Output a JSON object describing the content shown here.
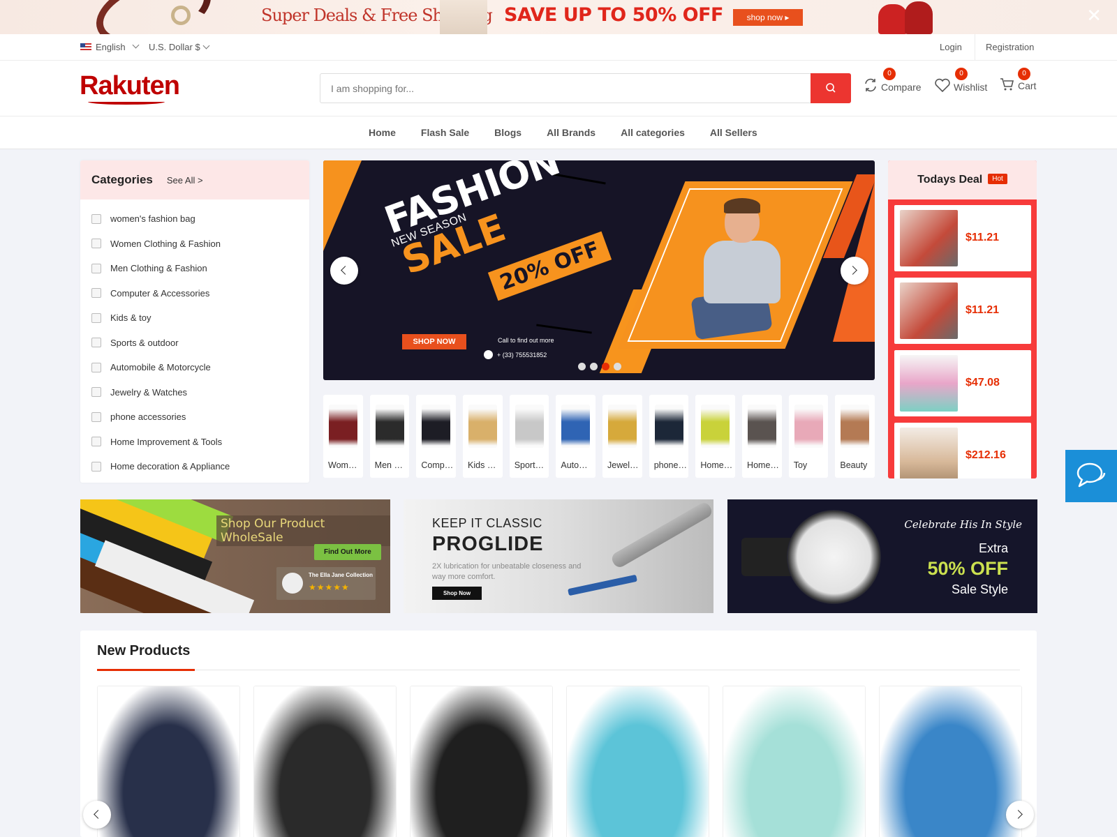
{
  "promo_banner": {
    "headline": "Super Deals & Free Shipping",
    "offer": "SAVE UP TO 50% OFF",
    "cta": "shop now ▸",
    "close_icon": "close-icon"
  },
  "utility_bar": {
    "language": "English",
    "currency": "U.S. Dollar $",
    "login": "Login",
    "registration": "Registration"
  },
  "header": {
    "logo": "Rakuten",
    "search_placeholder": "I am shopping for...",
    "compare": {
      "label": "Compare",
      "count": "0"
    },
    "wishlist": {
      "label": "Wishlist",
      "count": "0"
    },
    "cart": {
      "label": "Cart",
      "count": "0"
    }
  },
  "nav": {
    "items": [
      "Home",
      "Flash Sale",
      "Blogs",
      "All Brands",
      "All categories",
      "All Sellers"
    ]
  },
  "categories": {
    "title": "Categories",
    "see_all": "See All >",
    "items": [
      "women's fashion bag",
      "Women Clothing & Fashion",
      "Men Clothing & Fashion",
      "Computer & Accessories",
      "Kids & toy",
      "Sports & outdoor",
      "Automobile & Motorcycle",
      "Jewelry & Watches",
      "phone accessories",
      "Home Improvement & Tools",
      "Home decoration & Appliance"
    ]
  },
  "hero_slider": {
    "tagline": "NEW SEASON",
    "title": "FASHION",
    "subtitle": "SALE",
    "discount": "20% OFF",
    "cta": "SHOP NOW",
    "call_text": "Call to find out more",
    "phone": "+ (33) 755531852",
    "active_slide": 3,
    "slide_count": 4
  },
  "category_tiles": [
    {
      "label": "Women Clothing & Fashion",
      "color": "#7a1f22"
    },
    {
      "label": "Men Clothing & Fashion",
      "color": "#2b2b2b"
    },
    {
      "label": "Computer & Accessories",
      "color": "#1d1d25"
    },
    {
      "label": "Kids & toy",
      "color": "#d9b06a"
    },
    {
      "label": "Sports & outdoor",
      "color": "#c8c8c8"
    },
    {
      "label": "Automobile & Motorcycle",
      "color": "#2f64b4"
    },
    {
      "label": "Jewelry & Watches",
      "color": "#d6a93b"
    },
    {
      "label": "phone accessories",
      "color": "#1c2738"
    },
    {
      "label": "Home Improvement & Tools",
      "color": "#c9d23a"
    },
    {
      "label": "Home decoration & Appliance",
      "color": "#5a5350"
    },
    {
      "label": "Toy",
      "color": "#e8a9b8"
    },
    {
      "label": "Beauty",
      "color": "#b47a54"
    }
  ],
  "todays_deal": {
    "title": "Todays Deal",
    "badge": "Hot",
    "items": [
      {
        "price": "$11.21",
        "color": "#c44a3a"
      },
      {
        "price": "$11.21",
        "color": "#c44a3a"
      },
      {
        "price": "$47.08",
        "color": "#e9a6c9"
      },
      {
        "price": "$212.16",
        "color": "#d8b99a"
      }
    ]
  },
  "promo_tiles": {
    "wholesale": {
      "title": "Shop Our Product WholeSale",
      "cta": "Find Out More",
      "brand": "The Ella Jane Collection",
      "rating": "★★★★★"
    },
    "proglide": {
      "kicker": "KEEP IT CLASSIC",
      "title": "PROGLIDE",
      "desc": "2X lubrication for unbeatable closeness and way more comfort.",
      "cta": "Shop Now"
    },
    "watch": {
      "kicker": "Celebrate His In Style",
      "line1": "Extra",
      "line2": "50% OFF",
      "line3": "Sale Style"
    }
  },
  "new_products": {
    "title": "New Products",
    "items": [
      {
        "color": "#28304a"
      },
      {
        "color": "#2a2a2a"
      },
      {
        "color": "#1f1f1f"
      },
      {
        "color": "#5cc4d8"
      },
      {
        "color": "#a5e0d8"
      },
      {
        "color": "#3a86c8"
      }
    ]
  },
  "colors": {
    "accent": "#e62e04",
    "search_button": "#ec3530",
    "brand": "#bf0000",
    "chat": "#1b8fd8"
  }
}
